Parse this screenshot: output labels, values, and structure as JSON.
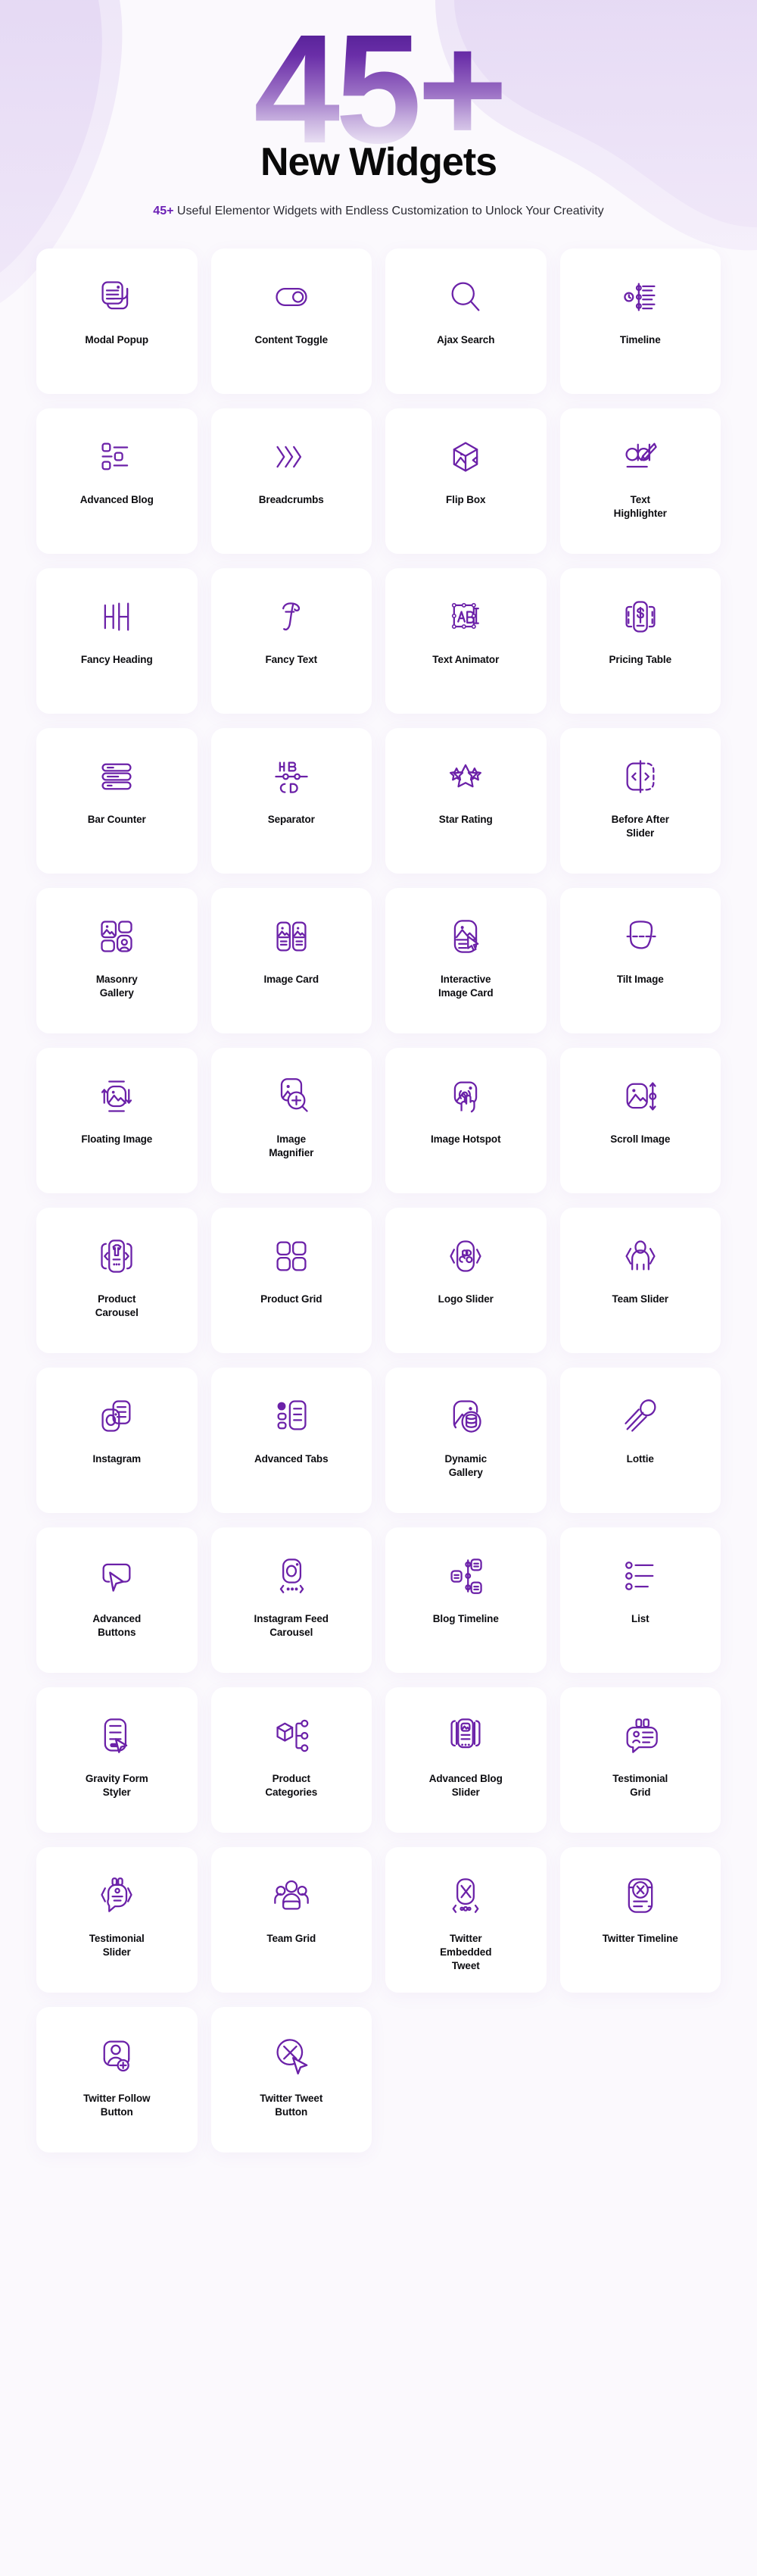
{
  "hero": {
    "number": "45+",
    "title": "New Widgets",
    "subtitle_accent": "45+",
    "subtitle_rest": " Useful Elementor Widgets with Endless Customization to Unlock Your Creativity"
  },
  "theme": {
    "accent_purple": "#6b20b5",
    "icon_stroke": "#6b21a8",
    "deep_purple": "#4c1b8f",
    "page_background": "#fbf9fd",
    "wave_light": "#e2d5f2",
    "card_background": "#ffffff",
    "label_color": "#0c0c10"
  },
  "widgets": [
    {
      "label": "Modal Popup",
      "icon": "modal-popup-icon"
    },
    {
      "label": "Content Toggle",
      "icon": "content-toggle-icon"
    },
    {
      "label": "Ajax Search",
      "icon": "ajax-search-icon"
    },
    {
      "label": "Timeline",
      "icon": "timeline-icon"
    },
    {
      "label": "Advanced Blog",
      "icon": "advanced-blog-icon"
    },
    {
      "label": "Breadcrumbs",
      "icon": "breadcrumbs-icon"
    },
    {
      "label": "Flip Box",
      "icon": "flip-box-icon"
    },
    {
      "label": "Text Highlighter",
      "icon": "text-highlighter-icon"
    },
    {
      "label": "Fancy Heading",
      "icon": "fancy-heading-icon"
    },
    {
      "label": "Fancy Text",
      "icon": "fancy-text-icon"
    },
    {
      "label": "Text Animator",
      "icon": "text-animator-icon"
    },
    {
      "label": "Pricing Table",
      "icon": "pricing-table-icon"
    },
    {
      "label": "Bar Counter",
      "icon": "bar-counter-icon"
    },
    {
      "label": "Separator",
      "icon": "separator-icon"
    },
    {
      "label": "Star Rating",
      "icon": "star-rating-icon"
    },
    {
      "label": "Before After Slider",
      "icon": "before-after-slider-icon"
    },
    {
      "label": "Masonry Gallery",
      "icon": "masonry-gallery-icon"
    },
    {
      "label": "Image Card",
      "icon": "image-card-icon"
    },
    {
      "label": "Interactive Image Card",
      "icon": "interactive-image-card-icon"
    },
    {
      "label": "Tilt Image",
      "icon": "tilt-image-icon"
    },
    {
      "label": "Floating Image",
      "icon": "floating-image-icon"
    },
    {
      "label": "Image Magnifier",
      "icon": "image-magnifier-icon"
    },
    {
      "label": "Image Hotspot",
      "icon": "image-hotspot-icon"
    },
    {
      "label": "Scroll Image",
      "icon": "scroll-image-icon"
    },
    {
      "label": "Product Carousel",
      "icon": "product-carousel-icon"
    },
    {
      "label": "Product Grid",
      "icon": "product-grid-icon"
    },
    {
      "label": "Logo Slider",
      "icon": "logo-slider-icon"
    },
    {
      "label": "Team Slider",
      "icon": "team-slider-icon"
    },
    {
      "label": "Instagram",
      "icon": "instagram-icon"
    },
    {
      "label": "Advanced Tabs",
      "icon": "advanced-tabs-icon"
    },
    {
      "label": "Dynamic Gallery",
      "icon": "dynamic-gallery-icon"
    },
    {
      "label": "Lottie",
      "icon": "lottie-icon"
    },
    {
      "label": "Advanced Buttons",
      "icon": "advanced-buttons-icon"
    },
    {
      "label": "Instagram Feed Carousel",
      "icon": "instagram-feed-carousel-icon"
    },
    {
      "label": "Blog Timeline",
      "icon": "blog-timeline-icon"
    },
    {
      "label": "List",
      "icon": "list-icon"
    },
    {
      "label": "Gravity Form Styler",
      "icon": "gravity-form-styler-icon"
    },
    {
      "label": "Product Categories",
      "icon": "product-categories-icon"
    },
    {
      "label": "Advanced Blog Slider",
      "icon": "advanced-blog-slider-icon"
    },
    {
      "label": "Testimonial Grid",
      "icon": "testimonial-grid-icon"
    },
    {
      "label": "Testimonial Slider",
      "icon": "testimonial-slider-icon"
    },
    {
      "label": "Team Grid",
      "icon": "team-grid-icon"
    },
    {
      "label": "Twitter Embedded Tweet",
      "icon": "twitter-embedded-tweet-icon"
    },
    {
      "label": "Twitter Timeline",
      "icon": "twitter-timeline-icon"
    },
    {
      "label": "Twitter Follow Button",
      "icon": "twitter-follow-button-icon"
    },
    {
      "label": "Twitter Tweet Button",
      "icon": "twitter-tweet-button-icon"
    }
  ]
}
